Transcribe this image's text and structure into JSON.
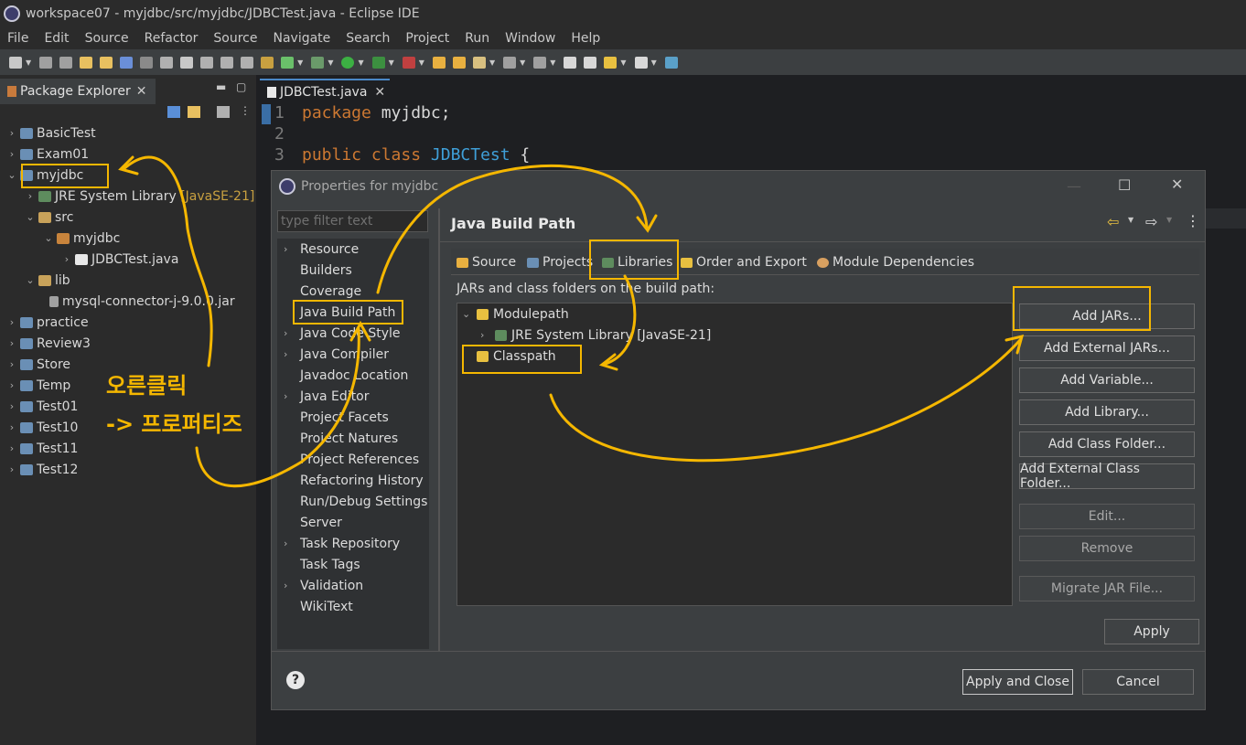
{
  "window": {
    "title": "workspace07 - myjdbc/src/myjdbc/JDBCTest.java - Eclipse IDE"
  },
  "menu": [
    "File",
    "Edit",
    "Source",
    "Refactor",
    "Source",
    "Navigate",
    "Search",
    "Project",
    "Run",
    "Window",
    "Help"
  ],
  "package_explorer": {
    "tab_label": "Package Explorer",
    "close": "✕",
    "tree": {
      "basictest": "BasicTest",
      "exam01": "Exam01",
      "myjdbc": "myjdbc",
      "jre": "JRE System Library",
      "jre_version": "[JavaSE-21]",
      "src": "src",
      "pkg": "myjdbc",
      "file": "JDBCTest.java",
      "lib": "lib",
      "jar": "mysql-connector-j-9.0.0.jar",
      "practice": "practice",
      "review3": "Review3",
      "store": "Store",
      "temp": "Temp",
      "test01": "Test01",
      "test10": "Test10",
      "test11": "Test11",
      "test12": "Test12"
    }
  },
  "editor": {
    "tab_label": "JDBCTest.java",
    "close": "✕",
    "lines": {
      "l1_num": "1",
      "l1_kw": "package",
      "l1_rest": " myjdbc;",
      "l2_num": "2",
      "l3_num": "3",
      "l3_kw": "public class",
      "l3_cls": "JDBCTest",
      "l3_rest": " {"
    }
  },
  "dialog": {
    "title": "Properties for myjdbc",
    "filter_placeholder": "type filter text",
    "nav": {
      "resource": "Resource",
      "builders": "Builders",
      "coverage": "Coverage",
      "java_build_path": "Java Build Path",
      "java_code_style": "Java Code Style",
      "java_compiler": "Java Compiler",
      "javadoc_location": "Javadoc Location",
      "java_editor": "Java Editor",
      "project_facets": "Project Facets",
      "project_natures": "Project Natures",
      "project_references": "Project References",
      "refactoring_history": "Refactoring History",
      "run_debug_settings": "Run/Debug Settings",
      "server": "Server",
      "task_repository": "Task Repository",
      "task_tags": "Task Tags",
      "validation": "Validation",
      "wikitext": "WikiText"
    },
    "page_title": "Java Build Path",
    "tabs": {
      "source": "Source",
      "projects": "Projects",
      "libraries": "Libraries",
      "order_export": "Order and Export",
      "module_deps": "Module Dependencies"
    },
    "build_path_label": "JARs and class folders on the build path:",
    "tree": {
      "modulepath": "Modulepath",
      "jre": "JRE System Library [JavaSE-21]",
      "classpath": "Classpath"
    },
    "buttons": {
      "add_jars": "Add JARs...",
      "add_external_jars": "Add External JARs...",
      "add_variable": "Add Variable...",
      "add_library": "Add Library...",
      "add_class_folder": "Add Class Folder...",
      "add_external_class_folder": "Add External Class Folder...",
      "edit": "Edit...",
      "remove": "Remove",
      "migrate_jar": "Migrate JAR File...",
      "apply": "Apply",
      "apply_and_close": "Apply and Close",
      "cancel": "Cancel"
    }
  },
  "annotation": {
    "line1": "오른클릭",
    "line2": "-> 프로퍼티즈",
    "color": "#f5b700"
  },
  "colors": {
    "accent": "#4a88c7",
    "keyword": "#cc7832",
    "class_name": "#3f9fd8",
    "highlight": "#f5b700"
  }
}
